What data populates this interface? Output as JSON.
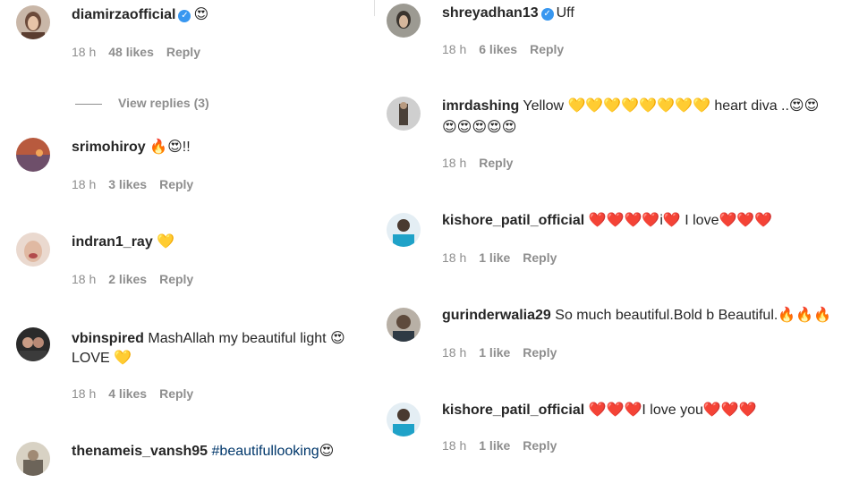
{
  "left": [
    {
      "user": "diamirzaofficial",
      "verified": true,
      "text": "😍",
      "time": "18 h",
      "likes": "48 likes",
      "reply": "Reply"
    },
    {
      "user": "srimohiroy",
      "verified": false,
      "text": "🔥😍!!",
      "time": "18 h",
      "likes": "3 likes",
      "reply": "Reply"
    },
    {
      "user": "indran1_ray",
      "verified": false,
      "text": "💛",
      "time": "18 h",
      "likes": "2 likes",
      "reply": "Reply"
    },
    {
      "user": "vbinspired",
      "verified": false,
      "text": "MashAllah my beautiful light 😍",
      "text2": "LOVE 💛",
      "time": "18 h",
      "likes": "4 likes",
      "reply": "Reply"
    },
    {
      "user": "thenameis_vansh95",
      "verified": false,
      "text": "#beautifullooking",
      "emoji": "😍"
    }
  ],
  "view_replies": "View replies (3)",
  "right": [
    {
      "user": "shreyadhan13",
      "verified": true,
      "text": "Uff",
      "time": "18 h",
      "likes": "6 likes",
      "reply": "Reply"
    },
    {
      "user": "imrdashing",
      "verified": false,
      "text": "Yellow 💛💛💛💛💛💛💛💛 heart diva ..😍😍",
      "text2": "😍😍😍😍😍",
      "time": "18 h",
      "reply": "Reply"
    },
    {
      "user": "kishore_patil_official",
      "verified": false,
      "text": "❤️❤️❤️❤️i❤️ I love❤️❤️❤️",
      "time": "18 h",
      "likes": "1 like",
      "reply": "Reply"
    },
    {
      "user": "gurinderwalia29",
      "verified": false,
      "text": "So much beautiful.Bold b Beautiful.🔥🔥🔥",
      "time": "18 h",
      "likes": "1 like",
      "reply": "Reply"
    },
    {
      "user": "kishore_patil_official",
      "verified": false,
      "text": "❤️❤️❤️I love you❤️❤️❤️",
      "time": "18 h",
      "likes": "1 like",
      "reply": "Reply"
    }
  ]
}
